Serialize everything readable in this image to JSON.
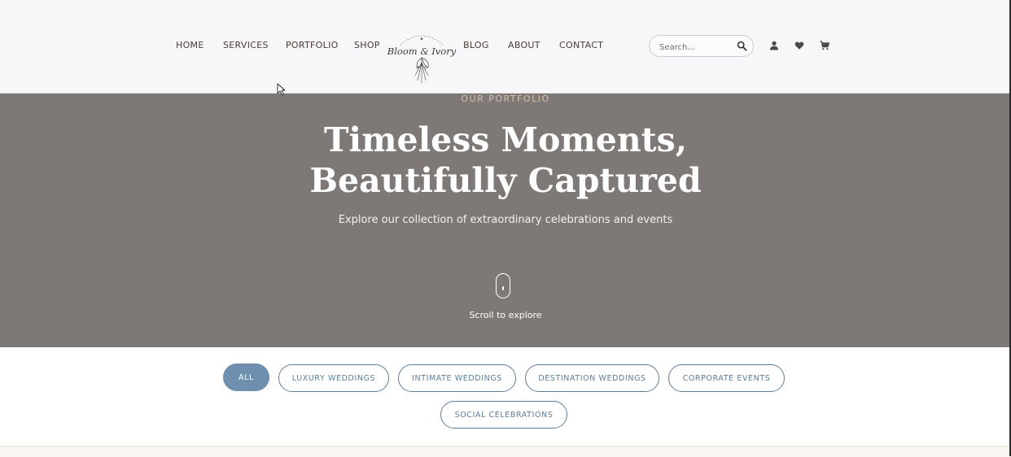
{
  "nav": {
    "left": [
      "HOME",
      "SERVICES",
      "PORTFOLIO",
      "SHOP"
    ],
    "right": [
      "BLOG",
      "ABOUT",
      "CONTACT"
    ]
  },
  "logo": {
    "text": "Bloom & Ivory"
  },
  "search": {
    "placeholder": "Search..."
  },
  "header_icons": [
    "user-icon",
    "heart-icon",
    "cart-icon",
    "search-icon"
  ],
  "hero": {
    "eyebrow": "OUR PORTFOLIO",
    "title_line1": "Timeless Moments,",
    "title_line2": "Beautifully Captured",
    "subtitle": "Explore our collection of extraordinary celebrations and events",
    "scroll_label": "Scroll to explore"
  },
  "filters": [
    {
      "label": "ALL",
      "active": true
    },
    {
      "label": "LUXURY WEDDINGS",
      "active": false
    },
    {
      "label": "INTIMATE WEDDINGS",
      "active": false
    },
    {
      "label": "DESTINATION WEDDINGS",
      "active": false
    },
    {
      "label": "CORPORATE EVENTS",
      "active": false
    },
    {
      "label": "SOCIAL CELEBRATIONS",
      "active": false
    }
  ],
  "colors": {
    "header_bg": "#f7f6f8",
    "nav_text": "#4a3b36",
    "hero_bg": "#7e7977",
    "eyebrow": "#d4c1b0",
    "accent_blue": "#5c7d9b",
    "active_pill": "#6f8faf"
  }
}
